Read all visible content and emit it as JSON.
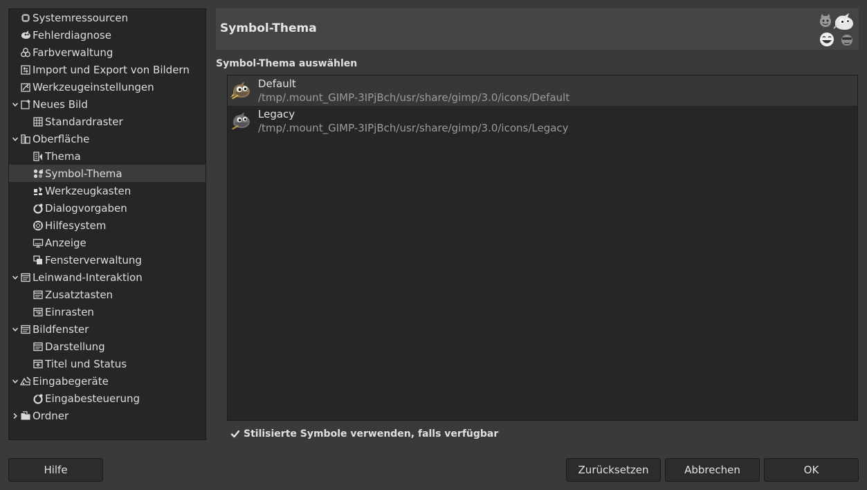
{
  "sidebar": {
    "items": [
      {
        "label": "Systemressourcen",
        "icon": "chip-icon",
        "level": 0,
        "expander": "none"
      },
      {
        "label": "Fehlerdiagnose",
        "icon": "bug-wilber-icon",
        "level": 0,
        "expander": "none"
      },
      {
        "label": "Farbverwaltung",
        "icon": "color-circles-icon",
        "level": 0,
        "expander": "none"
      },
      {
        "label": "Import und Export von Bildern",
        "icon": "import-export-icon",
        "level": 0,
        "expander": "none"
      },
      {
        "label": "Werkzeugeinstellungen",
        "icon": "tool-options-icon",
        "level": 0,
        "expander": "none"
      },
      {
        "label": "Neues Bild",
        "icon": "new-image-icon",
        "level": 0,
        "expander": "expanded"
      },
      {
        "label": "Standardraster",
        "icon": "grid-icon",
        "level": 1,
        "expander": "none"
      },
      {
        "label": "Oberfläche",
        "icon": "interface-icon",
        "level": 0,
        "expander": "expanded"
      },
      {
        "label": "Thema",
        "icon": "theme-icon",
        "level": 1,
        "expander": "none"
      },
      {
        "label": "Symbol-Thema",
        "icon": "icon-theme-icon",
        "level": 1,
        "expander": "none",
        "selected": true
      },
      {
        "label": "Werkzeugkasten",
        "icon": "toolbox-icon",
        "level": 1,
        "expander": "none"
      },
      {
        "label": "Dialogvorgaben",
        "icon": "dialog-defaults-icon",
        "level": 1,
        "expander": "none"
      },
      {
        "label": "Hilfesystem",
        "icon": "lifebuoy-icon",
        "level": 1,
        "expander": "none"
      },
      {
        "label": "Anzeige",
        "icon": "monitor-icon",
        "level": 1,
        "expander": "none"
      },
      {
        "label": "Fensterverwaltung",
        "icon": "windows-icon",
        "level": 1,
        "expander": "none"
      },
      {
        "label": "Leinwand-Interaktion",
        "icon": "window-icon",
        "level": 0,
        "expander": "expanded"
      },
      {
        "label": "Zusatztasten",
        "icon": "window-icon",
        "level": 1,
        "expander": "none"
      },
      {
        "label": "Einrasten",
        "icon": "snap-icon",
        "level": 1,
        "expander": "none"
      },
      {
        "label": "Bildfenster",
        "icon": "window-icon",
        "level": 0,
        "expander": "expanded"
      },
      {
        "label": "Darstellung",
        "icon": "window-icon",
        "level": 1,
        "expander": "none"
      },
      {
        "label": "Titel und Status",
        "icon": "title-status-icon",
        "level": 1,
        "expander": "none"
      },
      {
        "label": "Eingabegeräte",
        "icon": "input-devices-icon",
        "level": 0,
        "expander": "expanded"
      },
      {
        "label": "Eingabesteuerung",
        "icon": "dialog-defaults-icon",
        "level": 1,
        "expander": "none"
      },
      {
        "label": "Ordner",
        "icon": "folder-icon",
        "level": 0,
        "expander": "collapsed"
      }
    ]
  },
  "header": {
    "title": "Symbol-Thema",
    "icon": "icon-theme-faces-icon"
  },
  "section": {
    "label": "Symbol-Thema auswählen"
  },
  "themes": [
    {
      "name": "Default",
      "path": "/tmp/.mount_GIMP-3IPjBch/usr/share/gimp/3.0/icons/Default",
      "selected": true,
      "icon": "wilber-color-icon"
    },
    {
      "name": "Legacy",
      "path": "/tmp/.mount_GIMP-3IPjBch/usr/share/gimp/3.0/icons/Legacy",
      "selected": false,
      "icon": "wilber-legacy-icon"
    }
  ],
  "checkbox": {
    "label": "Stilisierte Symbole verwenden, falls verfügbar",
    "checked": true
  },
  "buttons": {
    "help": "Hilfe",
    "reset": "Zurücksetzen",
    "cancel": "Abbrechen",
    "ok": "OK"
  },
  "colors": {
    "background": "#3a3a3a",
    "panel": "#262626",
    "header": "#444444",
    "selected": "#3c3c3c",
    "text": "#dedede",
    "muted_text": "#9c9c9c"
  }
}
